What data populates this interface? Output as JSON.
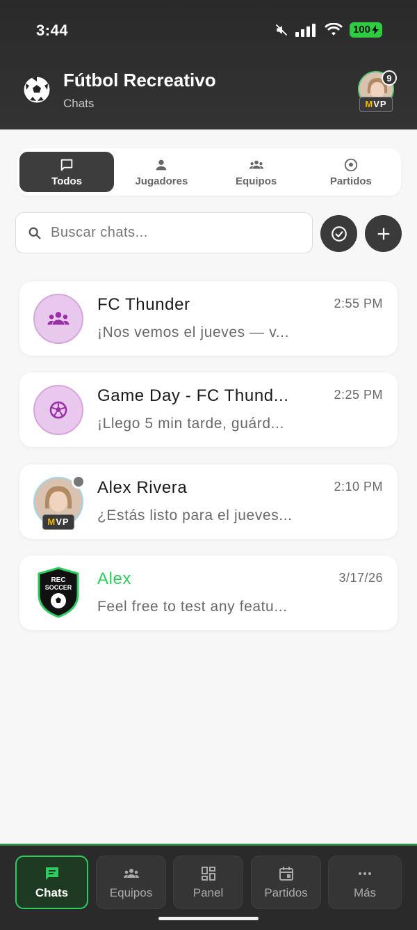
{
  "status_bar": {
    "time": "3:44",
    "battery": "100"
  },
  "header": {
    "title": "Fútbol Recreativo",
    "subtitle": "Chats",
    "notification_count": "9",
    "mvp_label_m": "M",
    "mvp_label_rest": "VP"
  },
  "filters": [
    {
      "label": "Todos",
      "icon": "chat-bubble-icon",
      "active": true
    },
    {
      "label": "Jugadores",
      "icon": "person-icon",
      "active": false
    },
    {
      "label": "Equipos",
      "icon": "group-icon",
      "active": false
    },
    {
      "label": "Partidos",
      "icon": "soccer-ball-icon",
      "active": false
    }
  ],
  "search": {
    "placeholder": "Buscar chats..."
  },
  "chats": [
    {
      "name": "FC Thunder",
      "message": "¡Nos vemos el jueves — v...",
      "time": "2:55 PM",
      "avatar": "group-icon"
    },
    {
      "name": "Game Day - FC Thund...",
      "message": "¡Llego 5 min tarde, guárd...",
      "time": "2:25 PM",
      "avatar": "soccer-ball-icon"
    },
    {
      "name": "Alex Rivera",
      "message": "¿Estás listo para el jueves...",
      "time": "2:10 PM",
      "avatar": "photo"
    },
    {
      "name": "Alex",
      "message": "Feel free to test any featu...",
      "time": "3/17/26",
      "avatar": "rec-soccer-logo",
      "logo_text": "REC SOCCER"
    }
  ],
  "bottom_nav": [
    {
      "label": "Chats",
      "icon": "chat-icon",
      "active": true
    },
    {
      "label": "Equipos",
      "icon": "group-icon",
      "active": false
    },
    {
      "label": "Panel",
      "icon": "dashboard-icon",
      "active": false
    },
    {
      "label": "Partidos",
      "icon": "calendar-icon",
      "active": false
    },
    {
      "label": "Más",
      "icon": "more-icon",
      "active": false
    }
  ],
  "colors": {
    "accent_green": "#2ecc60",
    "dark": "#3d3d3d",
    "purple": "#9a30a8"
  }
}
